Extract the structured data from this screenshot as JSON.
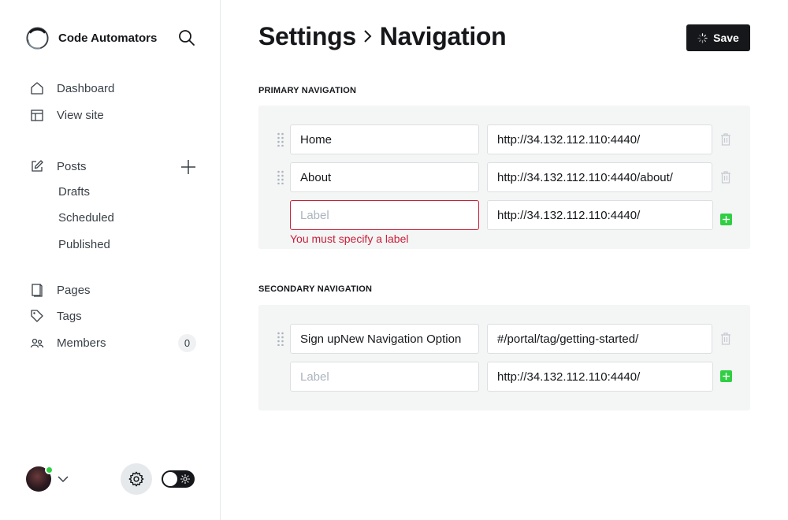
{
  "sidebar": {
    "brand_name": "Code Automators",
    "items": {
      "dashboard": "Dashboard",
      "view_site": "View site",
      "posts": "Posts",
      "drafts": "Drafts",
      "scheduled": "Scheduled",
      "published": "Published",
      "pages": "Pages",
      "tags": "Tags",
      "members": "Members"
    },
    "members_count": "0"
  },
  "header": {
    "crumb_parent": "Settings",
    "crumb_current": "Navigation",
    "save_label": "Save"
  },
  "primary": {
    "heading": "PRIMARY NAVIGATION",
    "items": [
      {
        "label": "Home",
        "url": "http://34.132.112.110:4440/"
      },
      {
        "label": "About",
        "url": "http://34.132.112.110:4440/about/"
      }
    ],
    "new_item": {
      "label_placeholder": "Label",
      "url": "http://34.132.112.110:4440/",
      "error": "You must specify a label"
    }
  },
  "secondary": {
    "heading": "SECONDARY NAVIGATION",
    "items": [
      {
        "label": "Sign upNew Navigation Option",
        "url": "#/portal/tag/getting-started/"
      }
    ],
    "new_item": {
      "label_placeholder": "Label",
      "url": "http://34.132.112.110:4440/"
    }
  },
  "colors": {
    "accent_green": "#30cf43",
    "error_red": "#c9203a",
    "dark": "#15171a",
    "panel_bg": "#f4f5f5"
  },
  "icons": [
    "logo-icon",
    "search-icon",
    "home-icon",
    "view-site-icon",
    "edit-icon",
    "plus-icon",
    "pages-icon",
    "tag-icon",
    "members-icon",
    "chevron-down-icon",
    "gear-icon",
    "sun-icon",
    "spinner-icon",
    "drag-handle-icon",
    "trash-icon",
    "add-icon"
  ]
}
